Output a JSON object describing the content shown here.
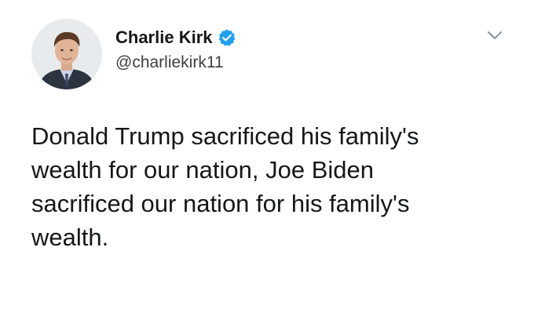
{
  "author": {
    "display_name": "Charlie Kirk",
    "handle": "@charliekirk11",
    "verified": true,
    "verified_color": "#1da1f2"
  },
  "tweet": {
    "lines": [
      "Donald Trump sacrificed his family's",
      "wealth for our nation, Joe Biden",
      "sacrificed our nation for his family's",
      "wealth."
    ]
  },
  "icons": {
    "verified": "verified-badge-icon",
    "menu": "chevron-down-icon"
  }
}
